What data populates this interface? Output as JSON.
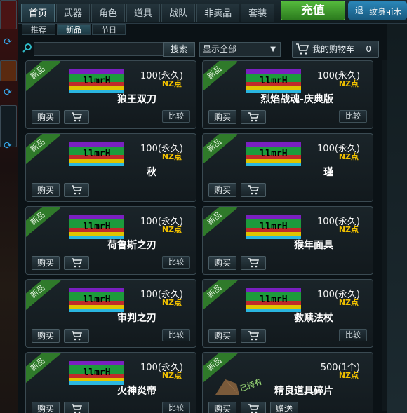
{
  "nav": {
    "tabs": [
      "首页",
      "武器",
      "角色",
      "道具",
      "战队",
      "非卖品",
      "套装"
    ],
    "active_tab": 0,
    "recharge_label": "充值",
    "top_right_label": "退",
    "watermark_text": "纹身чǐ木"
  },
  "subtabs": {
    "items": [
      "推荐",
      "新品",
      "节日"
    ],
    "active": 1
  },
  "search": {
    "placeholder": "",
    "button_label": "搜索"
  },
  "filter": {
    "selected": "显示全部"
  },
  "cart": {
    "label": "我的购物车",
    "count": "0"
  },
  "common": {
    "new_badge": "新品",
    "buy": "购买",
    "compare": "比较",
    "gift": "赠送",
    "currency": "NZ点",
    "owned": "已持有"
  },
  "items": [
    {
      "name": "狼王双刀",
      "price": "100(永久)",
      "compare": true
    },
    {
      "name": "烈焰战魂-庆典版",
      "price": "100(永久)",
      "compare": true
    },
    {
      "name": "秋",
      "price": "100(永久)",
      "compare": false
    },
    {
      "name": "瑾",
      "price": "100(永久)",
      "compare": false
    },
    {
      "name": "荷鲁斯之刃",
      "price": "100(永久)",
      "compare": true
    },
    {
      "name": "猴年面具",
      "price": "100(永久)",
      "compare": false
    },
    {
      "name": "审判之刃",
      "price": "100(永久)",
      "compare": true
    },
    {
      "name": "救赎法杖",
      "price": "100(永久)",
      "compare": true
    },
    {
      "name": "火神炎帝",
      "price": "100(永久)",
      "compare": true
    },
    {
      "name": "精良道具碎片",
      "price": "500(1个)",
      "compare": false,
      "gift": true,
      "owned": true
    }
  ],
  "colors": {
    "accent_green": "#2f7a2a",
    "price_yellow": "#f0c000",
    "recharge": "#54b93c"
  }
}
